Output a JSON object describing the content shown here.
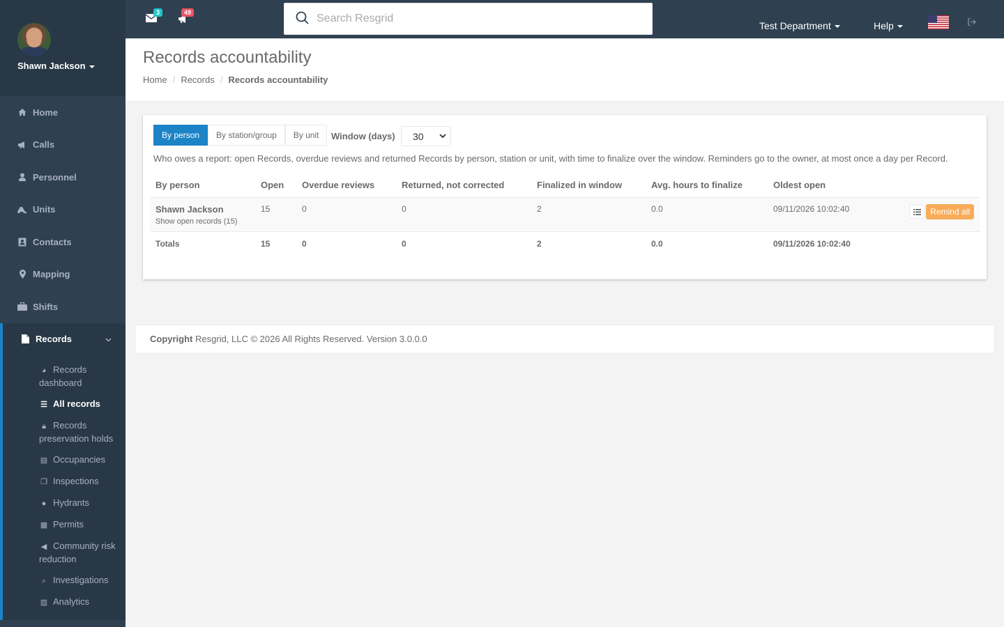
{
  "user": {
    "name": "Shawn Jackson"
  },
  "nav": {
    "items": [
      {
        "label": "Home",
        "icon": "home-icon"
      },
      {
        "label": "Calls",
        "icon": "bullhorn-icon"
      },
      {
        "label": "Personnel",
        "icon": "user-icon"
      },
      {
        "label": "Units",
        "icon": "truck-icon"
      },
      {
        "label": "Contacts",
        "icon": "address-book-icon"
      },
      {
        "label": "Mapping",
        "icon": "map-marker-icon"
      },
      {
        "label": "Shifts",
        "icon": "briefcase-icon"
      }
    ],
    "records": {
      "label": "Records",
      "sub": [
        {
          "label": "Records dashboard"
        },
        {
          "label": "All records"
        },
        {
          "label": "Records preservation holds"
        },
        {
          "label": "Occupancies"
        },
        {
          "label": "Inspections"
        },
        {
          "label": "Hydrants"
        },
        {
          "label": "Permits"
        },
        {
          "label": "Community risk reduction"
        },
        {
          "label": "Investigations"
        },
        {
          "label": "Analytics"
        }
      ]
    }
  },
  "topbar": {
    "mail_count": "3",
    "notif_count": "49",
    "search_placeholder": "Search Resgrid",
    "department": "Test Department",
    "help": "Help"
  },
  "header": {
    "title": "Records accountability",
    "breadcrumb": [
      "Home",
      "Records",
      "Records accountability"
    ]
  },
  "tabs": [
    "By person",
    "By station/group",
    "By unit"
  ],
  "window": {
    "label": "Window (days)",
    "value": "30"
  },
  "description": "Who owes a report: open Records, overdue reviews and returned Records by person, station or unit, with time to finalize over the window. Reminders go to the owner, at most once a day per Record.",
  "table": {
    "headers": [
      "By person",
      "Open",
      "Overdue reviews",
      "Returned, not corrected",
      "Finalized in window",
      "Avg. hours to finalize",
      "Oldest open"
    ],
    "rows": [
      {
        "name": "Shawn Jackson",
        "link": "Show open records (15)",
        "open": "15",
        "overdue": "0",
        "returned": "0",
        "finalized": "2",
        "avg": "0.0",
        "oldest": "09/11/2026 10:02:40",
        "action": "Remind all"
      }
    ],
    "totals": {
      "label": "Totals",
      "open": "15",
      "overdue": "0",
      "returned": "0",
      "finalized": "2",
      "avg": "0.0",
      "oldest": "09/11/2026 10:02:40"
    }
  },
  "footer": {
    "copyright": "Copyright",
    "text": "Resgrid, LLC © 2026 All Rights Reserved.",
    "version": "Version 3.0.0.0"
  },
  "colors": {
    "sidebar": "#2f4050",
    "accent": "#1c84c6",
    "warning": "#f8ac59"
  }
}
